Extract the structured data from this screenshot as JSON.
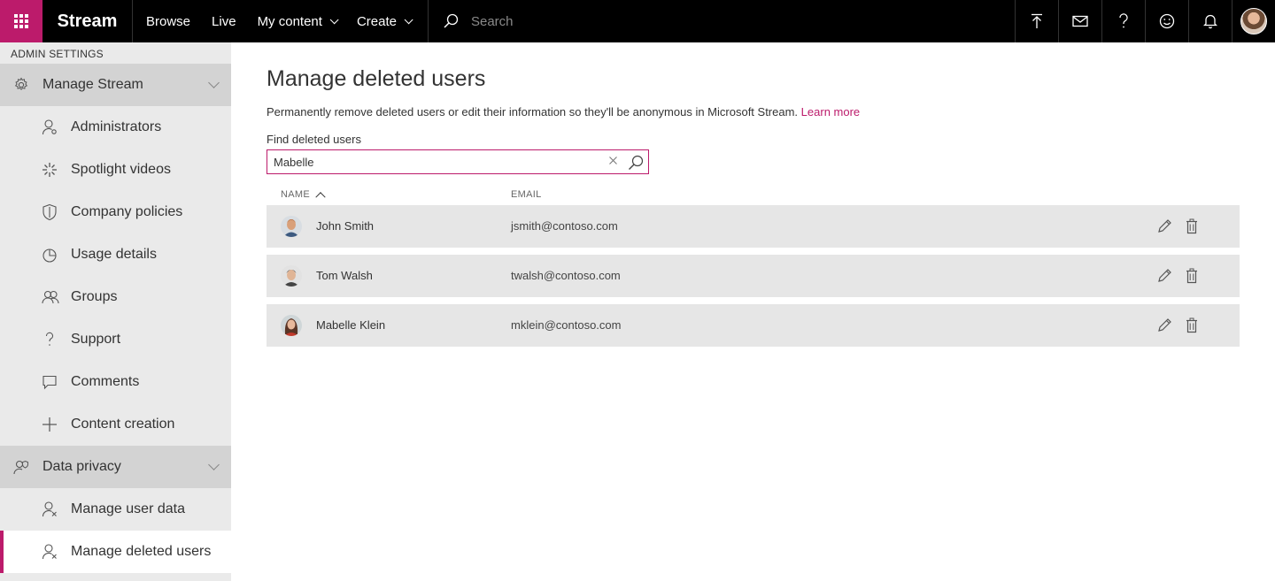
{
  "app": {
    "title": "Stream"
  },
  "topnav": {
    "items": [
      {
        "label": "Browse",
        "dropdown": false
      },
      {
        "label": "Live",
        "dropdown": false
      },
      {
        "label": "My content",
        "dropdown": true
      },
      {
        "label": "Create",
        "dropdown": true
      }
    ],
    "search_placeholder": "Search",
    "icons": [
      "upload-icon",
      "feedback-mail-icon",
      "help-icon",
      "smiley-icon",
      "bell-icon",
      "user-avatar"
    ]
  },
  "sidebar": {
    "header": "ADMIN SETTINGS",
    "section1": {
      "label": "Manage Stream",
      "icon": "gear-icon"
    },
    "items1": [
      {
        "label": "Administrators",
        "icon": "admin-person-icon"
      },
      {
        "label": "Spotlight videos",
        "icon": "spotlight-icon"
      },
      {
        "label": "Company policies",
        "icon": "shield-icon"
      },
      {
        "label": "Usage details",
        "icon": "pie-chart-icon"
      },
      {
        "label": "Groups",
        "icon": "groups-icon"
      },
      {
        "label": "Support",
        "icon": "question-icon"
      },
      {
        "label": "Comments",
        "icon": "comment-icon"
      },
      {
        "label": "Content creation",
        "icon": "plus-icon"
      }
    ],
    "section2": {
      "label": "Data privacy",
      "icon": "people-shield-icon"
    },
    "items2": [
      {
        "label": "Manage user data",
        "icon": "person-x-icon"
      },
      {
        "label": "Manage deleted users",
        "icon": "person-x-icon",
        "active": true
      }
    ]
  },
  "main": {
    "title": "Manage deleted users",
    "description": "Permanently remove deleted users or edit their information so they'll be anonymous in Microsoft Stream.",
    "learn_more": "Learn more",
    "find_label": "Find deleted users",
    "search_value": "Mabelle",
    "columns": {
      "name": "NAME",
      "email": "EMAIL"
    },
    "rows": [
      {
        "name": "John Smith",
        "email": "jsmith@contoso.com"
      },
      {
        "name": "Tom Walsh",
        "email": "twalsh@contoso.com"
      },
      {
        "name": "Mabelle Klein",
        "email": "mklein@contoso.com"
      }
    ]
  },
  "colors": {
    "accent": "#bc1b6b",
    "topbar": "#000000",
    "sidebar": "#eaeaea",
    "section": "#d3d3d3",
    "row": "#e6e6e6"
  }
}
